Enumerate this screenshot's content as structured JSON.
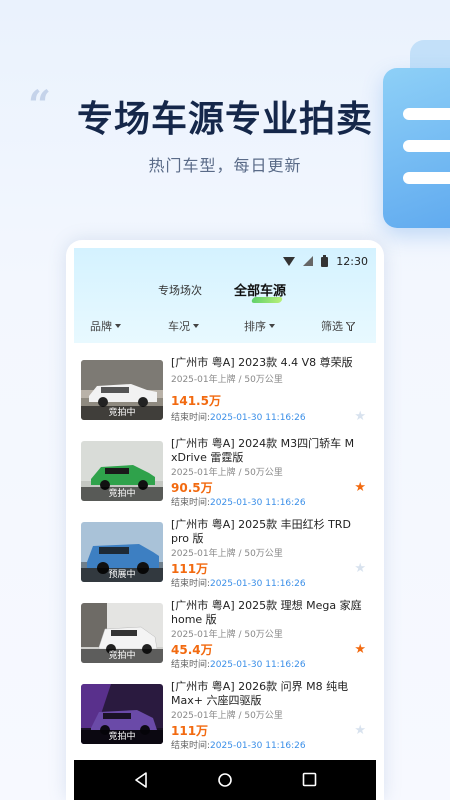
{
  "hero": {
    "title": "专场车源专业拍卖",
    "subtitle": "热门车型，每日更新"
  },
  "status_bar": {
    "time": "12:30"
  },
  "tabs": [
    {
      "label": "专场场次",
      "active": false
    },
    {
      "label": "全部车源",
      "active": true
    }
  ],
  "filters": [
    {
      "label": "品牌",
      "icon": "caret-down-icon"
    },
    {
      "label": "车况",
      "icon": "caret-down-icon"
    },
    {
      "label": "排序",
      "icon": "caret-down-icon"
    },
    {
      "label": "筛选",
      "icon": "filter-icon"
    }
  ],
  "listings": [
    {
      "title": "[广州市 粤A] 2023款 4.4 V8 尊荣版",
      "meta": "2025-01年上牌  /  50万公里",
      "price": "141.5万",
      "end_label": "结束时间:",
      "end_time": "2025-01-30 11:16:26",
      "badge": "竞拍中",
      "favorited": false
    },
    {
      "title": "[广州市 粤A] 2024款 M3四门轿车 M xDrive 雷霆版",
      "meta": "2025-01年上牌  /  50万公里",
      "price": "90.5万",
      "end_label": "结束时间:",
      "end_time": "2025-01-30 11:16:26",
      "badge": "竞拍中",
      "favorited": true
    },
    {
      "title": "[广州市 粤A] 2025款  丰田红杉 TRD pro 版",
      "meta": "2025-01年上牌  /  50万公里",
      "price": "111万",
      "end_label": "结束时间:",
      "end_time": "2025-01-30 11:16:26",
      "badge": "预展中",
      "favorited": false
    },
    {
      "title": "[广州市 粤A] 2025款 理想 Mega 家庭home 版",
      "meta": "2025-01年上牌  /  50万公里",
      "price": "45.4万",
      "end_label": "结束时间:",
      "end_time": "2025-01-30 11:16:26",
      "badge": "竞拍中",
      "favorited": true
    },
    {
      "title": "[广州市 粤A] 2026款 问界 M8 纯电 Max+ 六座四驱版",
      "meta": "2025-01年上牌  /  50万公里",
      "price": "111万",
      "end_label": "结束时间:",
      "end_time": "2025-01-30 11:16:26",
      "badge": "竞拍中",
      "favorited": false
    }
  ],
  "colors": {
    "price": "#f26a10",
    "time": "#3b8fe8",
    "hero_title": "#15274a"
  }
}
